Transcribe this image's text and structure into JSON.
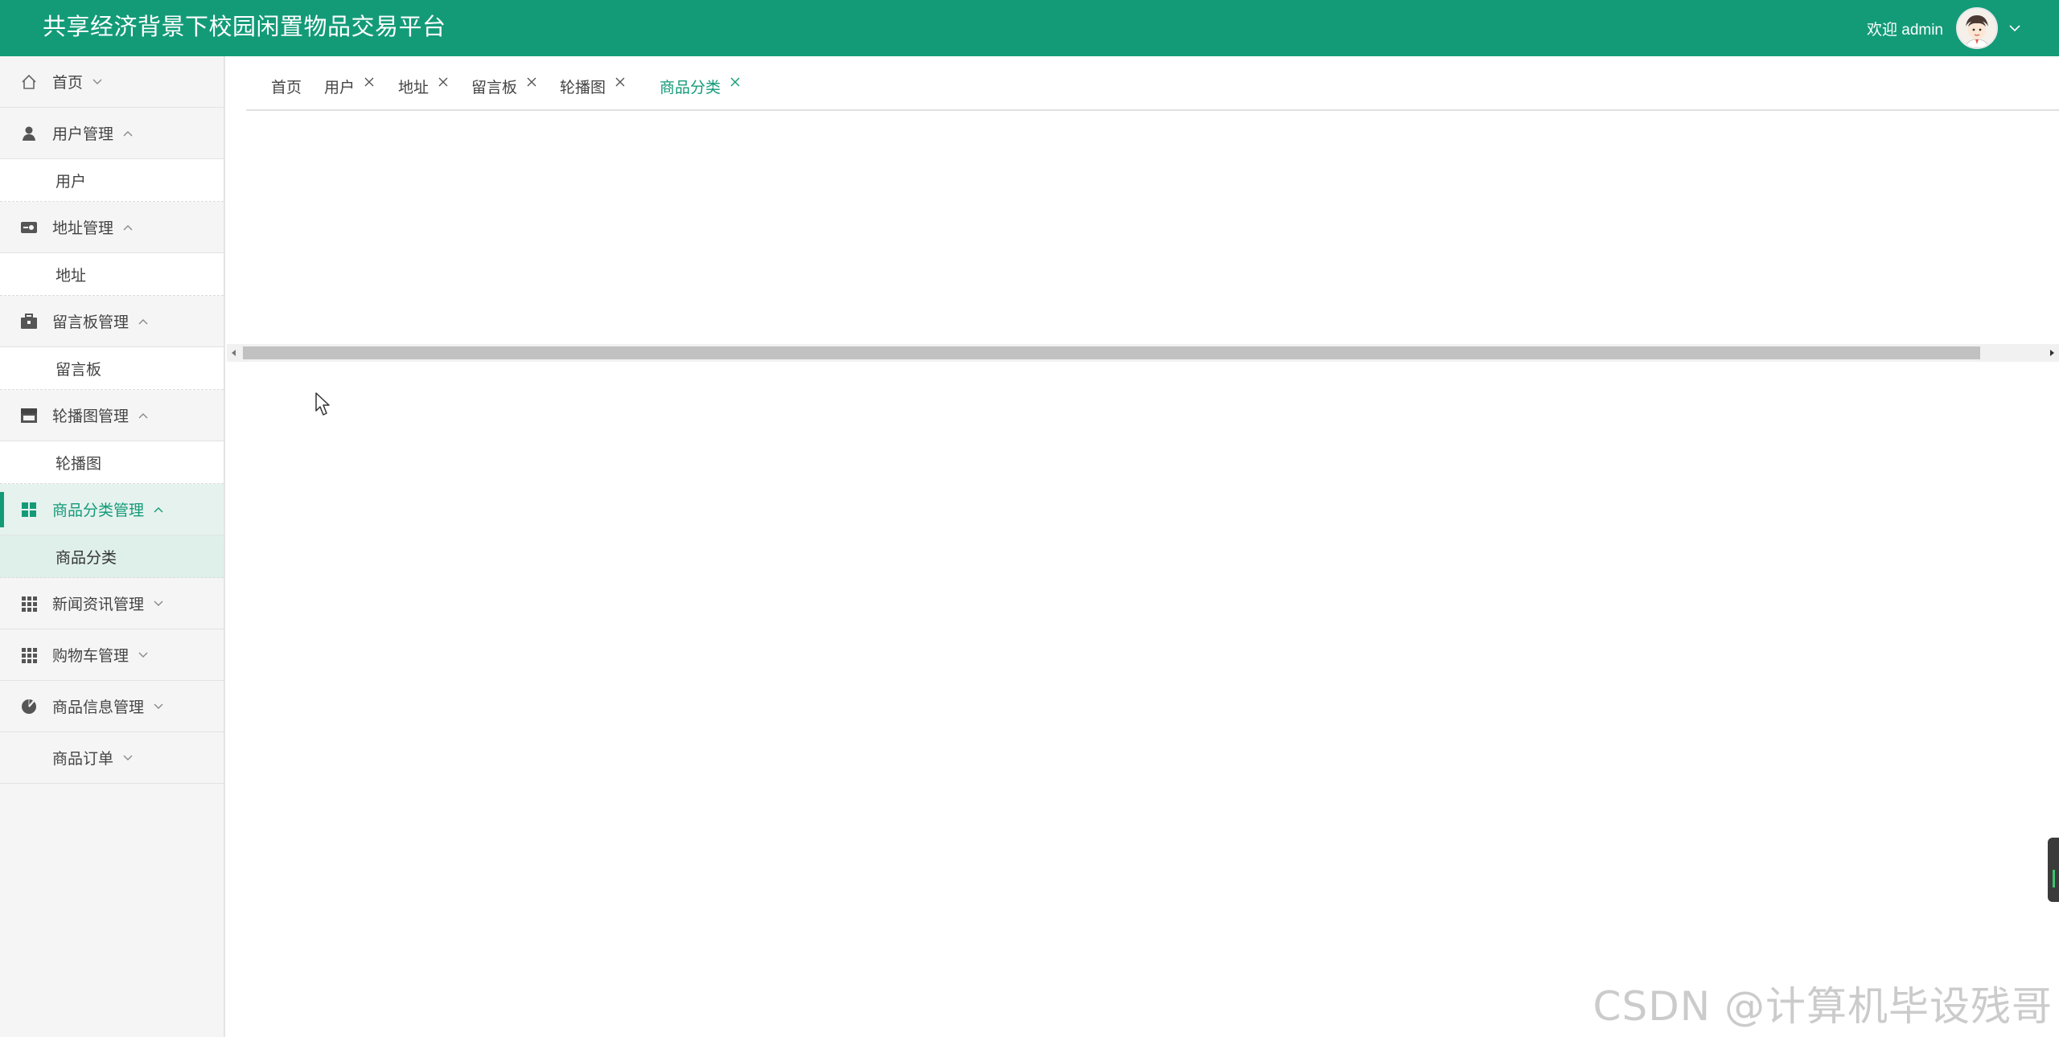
{
  "header": {
    "title": "共享经济背景下校园闲置物品交易平台",
    "welcome": "欢迎 admin",
    "brand_color": "#139b78"
  },
  "sidebar": {
    "menus": [
      {
        "label": "首页",
        "icon": "home-icon",
        "expanded": false,
        "children": []
      },
      {
        "label": "用户管理",
        "icon": "person-icon",
        "expanded": true,
        "children": [
          "用户"
        ]
      },
      {
        "label": "地址管理",
        "icon": "address-card-icon",
        "expanded": true,
        "children": [
          "地址"
        ]
      },
      {
        "label": "留言板管理",
        "icon": "briefcase-icon",
        "expanded": true,
        "children": [
          "留言板"
        ]
      },
      {
        "label": "轮播图管理",
        "icon": "shop-icon",
        "expanded": true,
        "children": [
          "轮播图"
        ]
      },
      {
        "label": "商品分类管理",
        "icon": "grid-four-icon",
        "expanded": true,
        "active": true,
        "children": [
          "商品分类"
        ]
      },
      {
        "label": "新闻资讯管理",
        "icon": "grid-nine-icon",
        "expanded": false,
        "children": []
      },
      {
        "label": "购物车管理",
        "icon": "grid-nine-icon",
        "expanded": false,
        "children": []
      },
      {
        "label": "商品信息管理",
        "icon": "pie-chart-icon",
        "expanded": false,
        "children": []
      },
      {
        "label": "商品订单",
        "icon": "",
        "expanded": false,
        "children": []
      }
    ],
    "active_submenu": "商品分类"
  },
  "tabs": [
    {
      "label": "首页",
      "closable": false,
      "active": false
    },
    {
      "label": "用户",
      "closable": true,
      "active": false
    },
    {
      "label": "地址",
      "closable": true,
      "active": false
    },
    {
      "label": "留言板",
      "closable": true,
      "active": false
    },
    {
      "label": "轮播图",
      "closable": true,
      "active": false
    },
    {
      "label": "商品分类",
      "closable": true,
      "active": true
    }
  ],
  "watermark": "CSDN @计算机毕设残哥"
}
